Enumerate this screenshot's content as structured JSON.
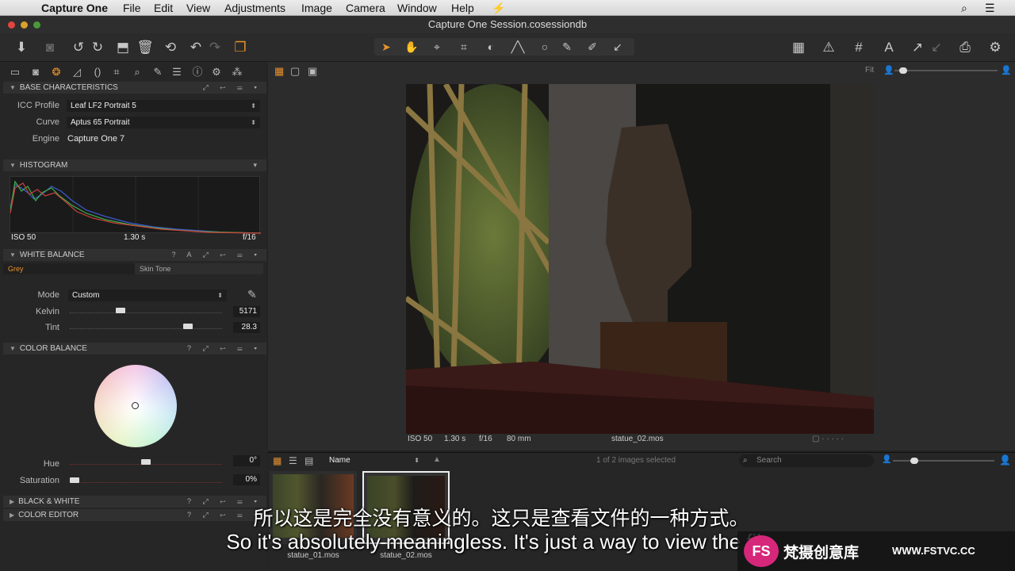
{
  "menubar": {
    "app_name": "Capture One",
    "items": [
      "File",
      "Edit",
      "View",
      "Adjustments",
      "Image",
      "Camera",
      "Window",
      "Help"
    ]
  },
  "window": {
    "title": "Capture One Session.cosessiondb"
  },
  "viewer": {
    "zoom_label": "Fit",
    "caption": {
      "iso": "ISO 50",
      "shutter": "1.30 s",
      "aperture": "f/16",
      "focal": "80 mm",
      "filename": "statue_02.mos"
    }
  },
  "base_characteristics": {
    "title": "BASE CHARACTERISTICS",
    "icc_label": "ICC Profile",
    "icc_value": "Leaf LF2 Portrait 5",
    "curve_label": "Curve",
    "curve_value": "Aptus 65 Portrait",
    "engine_label": "Engine",
    "engine_value": "Capture One 7"
  },
  "histogram": {
    "title": "HISTOGRAM",
    "iso": "ISO 50",
    "shutter": "1.30 s",
    "aperture": "f/16"
  },
  "white_balance": {
    "title": "WHITE BALANCE",
    "tab_grey": "Grey",
    "tab_skin": "Skin Tone",
    "mode_label": "Mode",
    "mode_value": "Custom",
    "kelvin_label": "Kelvin",
    "kelvin_value": "5171",
    "tint_label": "Tint",
    "tint_value": "28.3"
  },
  "color_balance": {
    "title": "COLOR BALANCE",
    "hue_label": "Hue",
    "hue_value": "0°",
    "saturation_label": "Saturation",
    "saturation_value": "0%"
  },
  "collapsed_tools": {
    "black_white": "BLACK & WHITE",
    "color_editor": "COLOR EDITOR"
  },
  "browser": {
    "sort_label": "Name",
    "selection_status": "1 of 2 images selected",
    "search_placeholder": "Search",
    "thumbnails": [
      {
        "name": "statue_01.mos"
      },
      {
        "name": "statue_02.mos"
      }
    ]
  },
  "subtitles": {
    "chinese": "所以这是完全没有意义的。这只是查看文件的一种方式。",
    "english": "So it's absolutely meaningless. It's just a way to view the file"
  },
  "watermark": {
    "logo": "FS",
    "text_cn": "梵摄创意库",
    "url": "WWW.FSTVC.CC"
  },
  "colors": {
    "accent_orange": "#e8912c",
    "panel_bg": "#262626",
    "header_bg": "#303030"
  }
}
